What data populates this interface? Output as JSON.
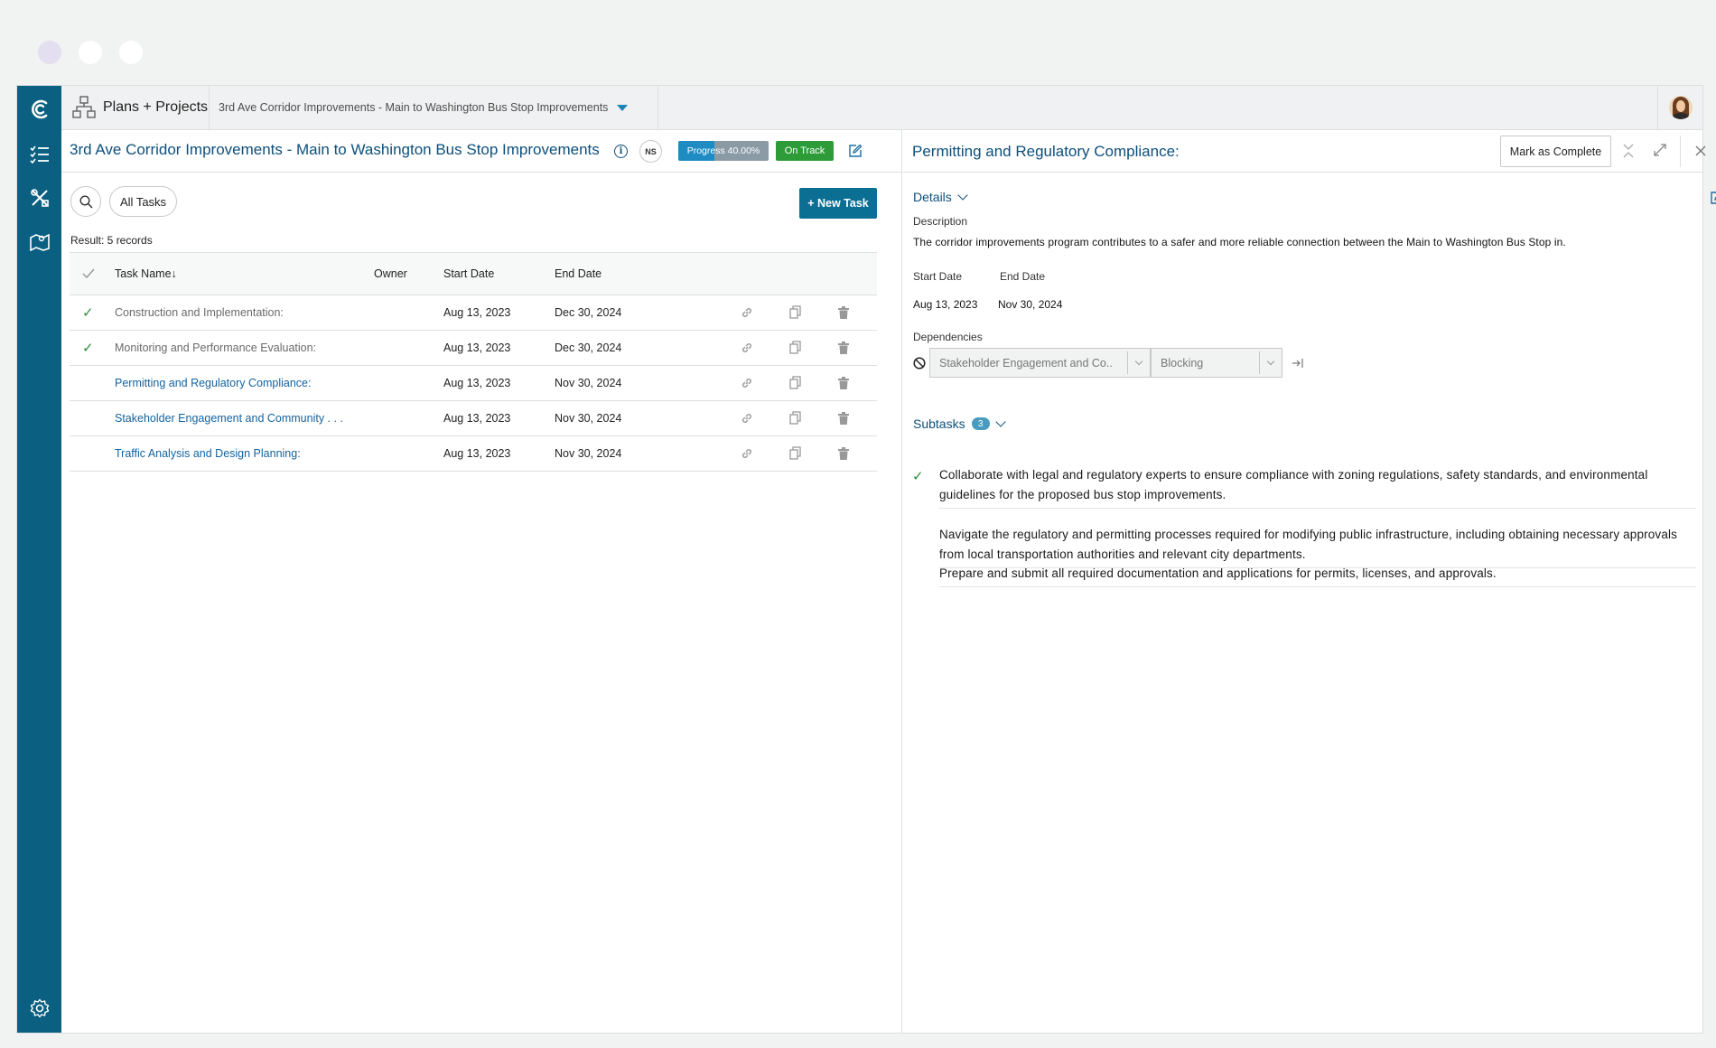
{
  "app": {
    "section": "Plans + Projects",
    "breadcrumb": "3rd Ave Corridor Improvements - Main to Washington Bus Stop Improvements"
  },
  "colors": {
    "rail": "#0b5f80",
    "title_blue": "#0d4f7b",
    "progress": "#1f8bc3",
    "on_track": "#2e9b39",
    "check": "#2e8b3a"
  },
  "project": {
    "title": "3rd Ave Corridor Improvements - Main to Washington Bus Stop Improvements",
    "owner_initials": "NS",
    "progress_label": "Progress 40.00%",
    "progress_value": 0.4,
    "status": "On Track"
  },
  "toolbar": {
    "filter_label": "All Tasks",
    "new_task_label": "+ New Task",
    "result_text": "Result: 5 records"
  },
  "table": {
    "columns": {
      "name": "Task Name↓",
      "owner": "Owner",
      "start": "Start Date",
      "end": "End Date"
    },
    "rows": [
      {
        "name": "Construction and Implementation:",
        "owner": "",
        "start": "Aug 13, 2023",
        "end": "Dec 30, 2024",
        "completed": true
      },
      {
        "name": "Monitoring and Performance Evaluation:",
        "owner": "",
        "start": "Aug 13, 2023",
        "end": "Dec 30, 2024",
        "completed": true
      },
      {
        "name": "Permitting and Regulatory Compliance:",
        "owner": "",
        "start": "Aug 13, 2023",
        "end": "Nov 30, 2024",
        "completed": false
      },
      {
        "name": "Stakeholder Engagement and Community . . .",
        "owner": "",
        "start": "Aug 13, 2023",
        "end": "Nov 30, 2024",
        "completed": false
      },
      {
        "name": "Traffic Analysis and Design Planning:",
        "owner": "",
        "start": "Aug 13, 2023",
        "end": "Nov 30, 2024",
        "completed": false
      }
    ]
  },
  "detail": {
    "title": "Permitting and Regulatory Compliance:",
    "mark_complete_label": "Mark as Complete",
    "details_label": "Details",
    "description_label": "Description",
    "description": "The corridor improvements program contributes to a safer and more reliable connection between the Main to Washington Bus Stop in.",
    "start_label": "Start Date",
    "end_label": "End Date",
    "start_value": "Aug 13, 2023",
    "end_value": "Nov 30, 2024",
    "dependencies_label": "Dependencies",
    "dependency_task": "Stakeholder Engagement and Co..",
    "dependency_type": "Blocking",
    "subtasks_label": "Subtasks",
    "subtasks_count": "3",
    "subtasks": [
      {
        "text": "Collaborate with legal and regulatory experts to ensure compliance with zoning regulations, safety standards, and environmental guidelines for the proposed bus stop improvements.",
        "completed": true
      },
      {
        "text": "Navigate the regulatory and permitting processes required for modifying public infrastructure, including obtaining necessary approvals from local transportation authorities and relevant city departments.",
        "completed": false
      },
      {
        "text": "Prepare and submit all required documentation and applications for permits, licenses, and approvals.",
        "completed": false
      }
    ]
  }
}
